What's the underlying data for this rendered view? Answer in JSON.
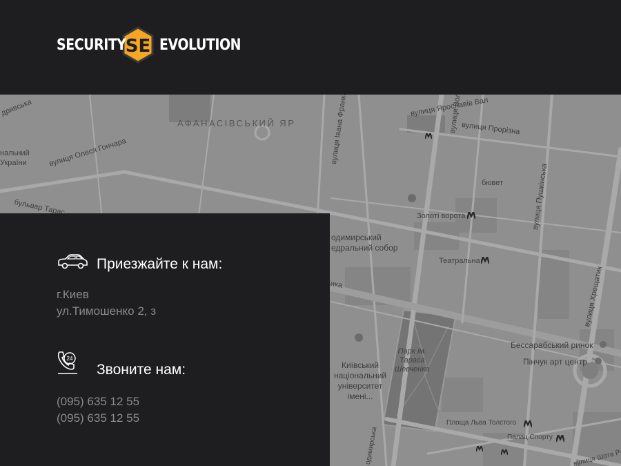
{
  "brand": {
    "left_word": "SECURITY",
    "right_word": "EVOLUTION",
    "mark_letters": "SE",
    "accent_color": "#f5a623"
  },
  "map": {
    "labels": {
      "afanasiv": "АФАНАСІВСЬКИЙ ЯР",
      "honchara": "вулиця Олеся Гончара",
      "ivana_franka": "вулиця Івана Франка",
      "yaroslaviv_val": "вулиця Ярославів Вал",
      "volodymyrska_top": "вулиця Волод",
      "prorizna": "вулиця Прорізна",
      "biuvet": "бювет",
      "zoloti_vorota": "Золоті ворота",
      "pushkinska": "вулиця Пушкінська",
      "volodymyrskyi_sobor": "одимирський\nедральний собор",
      "teatralna": "Театральна",
      "khreshchatyk": "вулиця Хрещатик",
      "bessarabskyi": "Бессарабський ринок",
      "pinchuk": "Пінчук арт центр",
      "park": "Парк ім.\nТараса\nШевченка",
      "university": "Київський\nнаціональний\nуніверситет\nімені...",
      "lva_tolstoho": "Площа Льва Толстого",
      "palats_sportu": "Палац Спорту",
      "shota_rustaveli": "вулиця Шота Руставелі",
      "volodymyrska_bottom": "одимирська",
      "bulvar": "бульвар Тарас",
      "ukrainy": "нальний\nУкраїни",
      "dryavska": "дрявська",
      "ika": "ика"
    }
  },
  "contact": {
    "visit_title": "Приезжайте к нам:",
    "city": "г.Киев",
    "street": "ул.Тимошенко 2, з",
    "call_title": "Звоните нам:",
    "phone1": "(095) 635 12 55",
    "phone2": "(095) 635 12 55"
  },
  "icons": {
    "car": "car-icon",
    "phone": "phone-24-icon",
    "metro": "metro-icon"
  }
}
